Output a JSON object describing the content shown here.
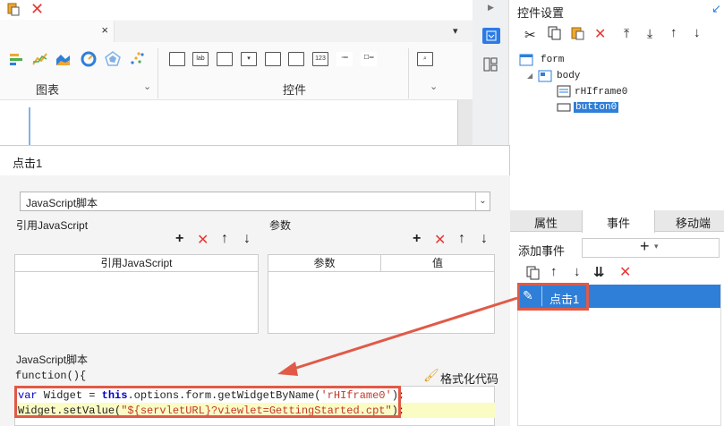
{
  "toolbar": {
    "tab_close": "×",
    "groups": [
      {
        "label": "图表"
      },
      {
        "label": "控件"
      }
    ],
    "control_icons": [
      "",
      "lab",
      "",
      "",
      "",
      "123",
      "",
      "",
      ""
    ]
  },
  "right_panel": {
    "title": "控件设置",
    "tree": {
      "root": "form",
      "body": "body",
      "children": [
        "rHIframe0",
        "button0"
      ]
    },
    "tabs": [
      "属性",
      "事件",
      "移动端"
    ],
    "add_event_label": "添加事件",
    "add_event_plus": "+",
    "events": [
      "点击1"
    ]
  },
  "dialog": {
    "title": "点击1",
    "type_value": "JavaScript脚本",
    "ref_js_label": "引用JavaScript",
    "params_label": "参数",
    "ref_js_header": "引用JavaScript",
    "params_header": "参数",
    "value_header": "值",
    "script_label": "JavaScript脚本",
    "function_sig": "function(){",
    "format_label": "格式化代码",
    "code_line1_var": "var",
    "code_line1_mid": " Widget = ",
    "code_line1_this": "this",
    "code_line1_rest": ".options.form.getWidgetByName(",
    "code_line1_str": "'rHIframe0'",
    "code_line1_end": ");",
    "code_line2_pre": "Widget.setValue(",
    "code_line2_str": "\"${servletURL}?viewlet=GettingStarted.cpt\"",
    "code_line2_end": ");"
  },
  "colors": {
    "accent": "#2f7fd8",
    "highlight_red": "#e05a47",
    "keyword_blue": "#0000c8",
    "string_red": "#c0392b"
  }
}
